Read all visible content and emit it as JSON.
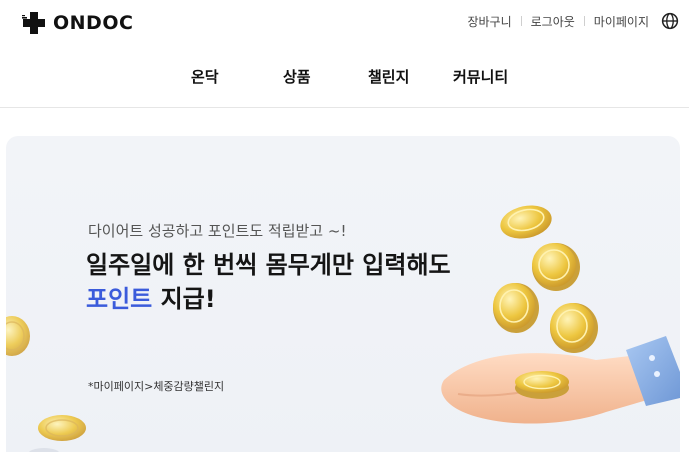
{
  "brand": {
    "name": "ONDOC"
  },
  "utility_nav": {
    "cart": "장바구니",
    "logout": "로그아웃",
    "mypage": "마이페이지"
  },
  "icons": [
    "medical-cross-logo-icon",
    "globe-icon",
    "coin-icon",
    "hand-icon"
  ],
  "main_nav": [
    {
      "label": "온닥"
    },
    {
      "label": "상품"
    },
    {
      "label": "챌린지"
    },
    {
      "label": "커뮤니티"
    }
  ],
  "banner": {
    "subtitle": "다이어트 성공하고 포인트도 적립받고 ~!",
    "headline_line1": "일주일에 한 번씩 몸무게만 입력해도",
    "headline_highlight": "포인트",
    "headline_line2_rest": " 지급!",
    "path_note": "*마이페이지>체중감량챌린지",
    "colors": {
      "background": "#eef1f6",
      "highlight": "#3b5bdb",
      "coin": "#e8c23a"
    }
  }
}
